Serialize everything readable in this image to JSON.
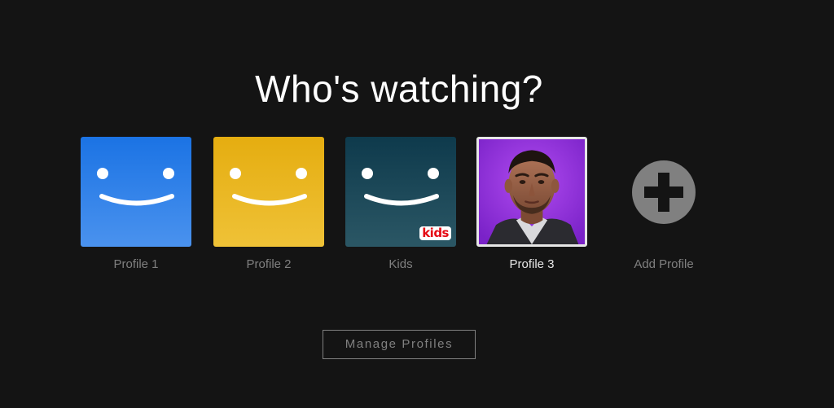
{
  "heading": "Who's watching?",
  "profiles": [
    {
      "label": "Profile 1",
      "avatar": "smiley-blue",
      "color": "#2a7de6"
    },
    {
      "label": "Profile 2",
      "avatar": "smiley-yellow",
      "color": "#e8b41c"
    },
    {
      "label": "Kids",
      "avatar": "smiley-teal-kids",
      "color": "#1c4a5a",
      "badge": "kids"
    },
    {
      "label": "Profile 3",
      "avatar": "photo-portrait",
      "color": "#8a2be2",
      "selected": true
    }
  ],
  "add_profile": {
    "label": "Add Profile",
    "icon": "plus-circle-icon"
  },
  "manage_button": {
    "label": "Manage Profiles"
  },
  "colors": {
    "background": "#141414",
    "text_muted": "#808080",
    "text_active": "#e6e6e6",
    "kids_red": "#e50914"
  }
}
